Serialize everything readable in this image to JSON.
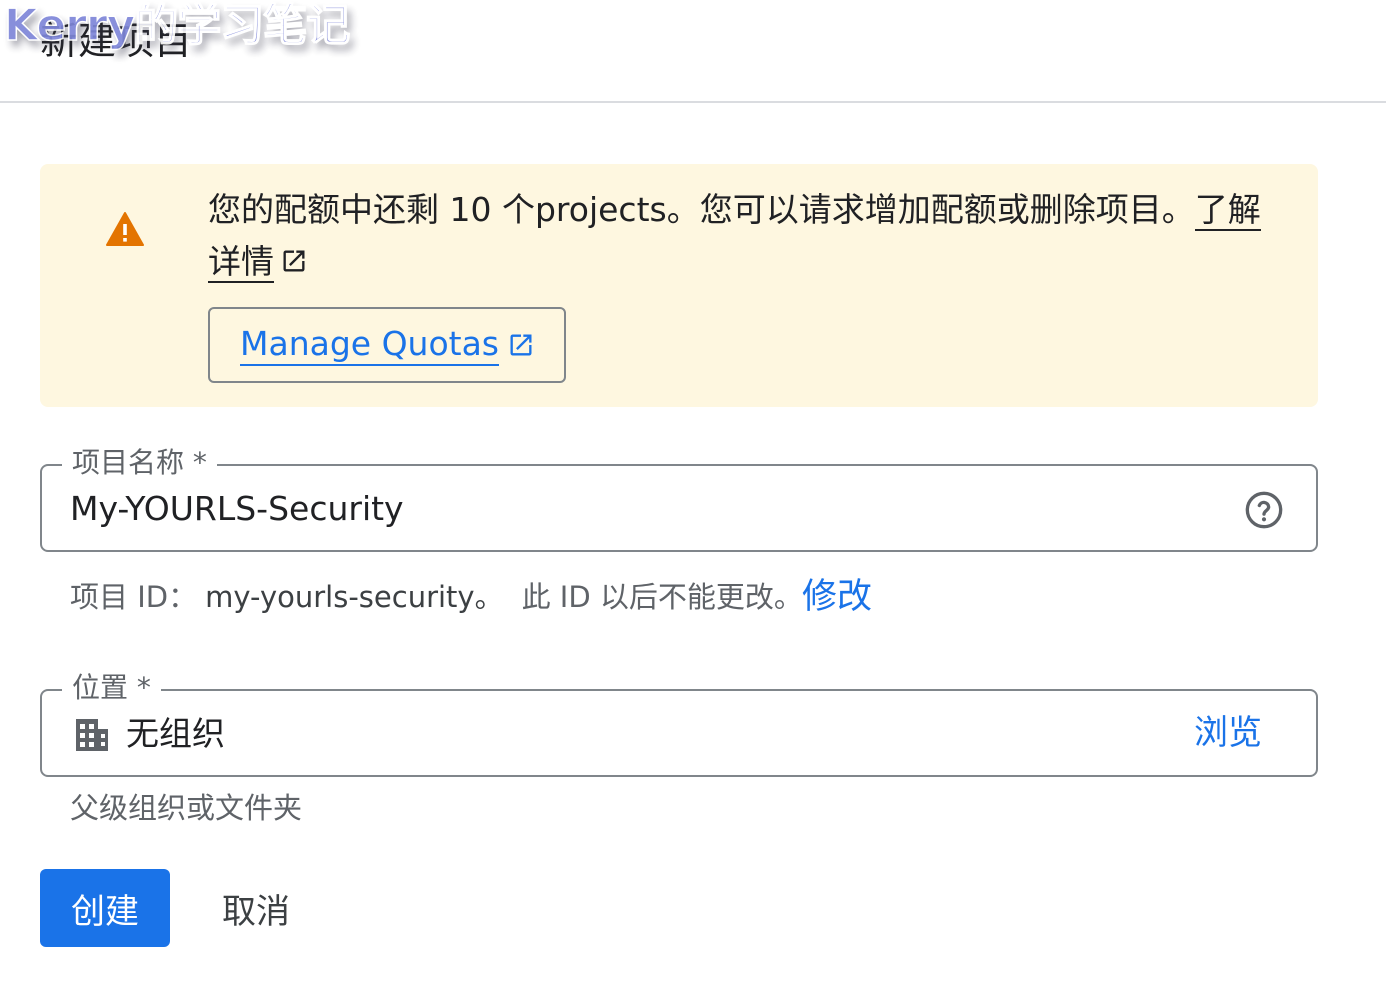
{
  "watermark": {
    "text": "Kerry的学习笔记"
  },
  "header": {
    "title": "新建项目"
  },
  "banner": {
    "icon": "warning-icon",
    "message": "您的配额中还剩 10 个projects。您可以请求增加配额或删除项目。",
    "learn_more": "了解详情",
    "manage_quotas_label": "Manage Quotas",
    "link_icon": "external-link-icon"
  },
  "project_name": {
    "label": "项目名称 *",
    "value": "My-YOURLS-Security",
    "help_icon": "help-circle-icon"
  },
  "project_id": {
    "prefix": "项目 ID：",
    "value": "my-yourls-security。",
    "note": "此 ID 以后不能更改。",
    "edit_label": "修改"
  },
  "location": {
    "label": "位置 *",
    "icon": "organization-icon",
    "value": "无组织",
    "browse_label": "浏览",
    "helper": "父级组织或文件夹"
  },
  "actions": {
    "create_label": "创建",
    "cancel_label": "取消"
  },
  "colors": {
    "accent": "#1a73e8",
    "warning_bg": "#fef7e0",
    "warning_icon": "#e37400",
    "border": "#80868b",
    "divider": "#dadce0"
  }
}
